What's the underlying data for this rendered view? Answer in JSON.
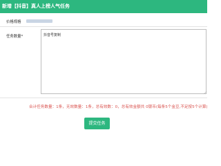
{
  "dialog": {
    "title": "新增【抖音】真人上榜人气任务"
  },
  "form": {
    "price_label": "价格规格",
    "price_value": "",
    "quantity_label": "任务数量*",
    "textarea_placeholder": "抖音号复制"
  },
  "summary": {
    "text": "合计任务数量：1条，无效数量：1条，总有效数：0，总有效金额共 0银币(每条5个金豆,不足按5个计算)"
  },
  "actions": {
    "submit_label": "提交任务"
  },
  "colors": {
    "brand": "#2db77f",
    "warning": "#d9534f",
    "redacted_value": "#c9d5e4"
  }
}
